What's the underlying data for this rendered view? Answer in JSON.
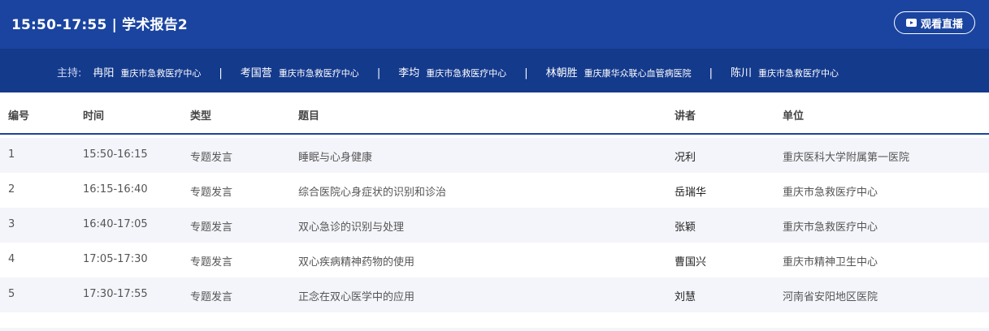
{
  "header": {
    "title": "15:50-17:55 | 学术报告2",
    "live_button_label": "观看直播"
  },
  "hosts": {
    "label": "主持:",
    "separator": "|",
    "items": [
      {
        "name": "冉阳",
        "org": "重庆市急救医疗中心"
      },
      {
        "name": "考国营",
        "org": "重庆市急救医疗中心"
      },
      {
        "name": "李均",
        "org": "重庆市急救医疗中心"
      },
      {
        "name": "林朝胜",
        "org": "重庆康华众联心血管病医院"
      },
      {
        "name": "陈川",
        "org": "重庆市急救医疗中心"
      }
    ]
  },
  "table": {
    "headers": {
      "no": "编号",
      "time": "时间",
      "type": "类型",
      "topic": "题目",
      "speaker": "讲者",
      "org": "单位"
    },
    "rows": [
      {
        "no": "1",
        "time": "15:50-16:15",
        "type": "专题发言",
        "topic": "睡眠与心身健康",
        "speaker": "况利",
        "org": "重庆医科大学附属第一医院"
      },
      {
        "no": "2",
        "time": "16:15-16:40",
        "type": "专题发言",
        "topic": "综合医院心身症状的识别和诊治",
        "speaker": "岳瑞华",
        "org": "重庆市急救医疗中心"
      },
      {
        "no": "3",
        "time": "16:40-17:05",
        "type": "专题发言",
        "topic": "双心急诊的识别与处理",
        "speaker": "张颖",
        "org": "重庆市急救医疗中心"
      },
      {
        "no": "4",
        "time": "17:05-17:30",
        "type": "专题发言",
        "topic": "双心疾病精神药物的使用",
        "speaker": "曹国兴",
        "org": "重庆市精神卫生中心"
      },
      {
        "no": "5",
        "time": "17:30-17:55",
        "type": "专题发言",
        "topic": "正念在双心医学中的应用",
        "speaker": "刘慧",
        "org": "河南省安阳地区医院"
      }
    ]
  },
  "colors": {
    "header_bg": "#1a44a0",
    "hosts_bg": "#143a8c",
    "row_alt_bg": "#f4f5fa"
  },
  "icons": {
    "live_button": "play-icon"
  }
}
